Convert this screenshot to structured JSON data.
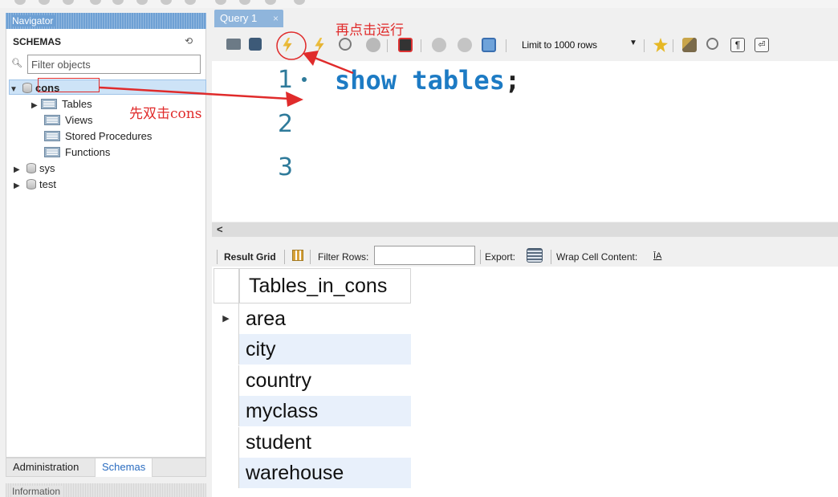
{
  "navigator": {
    "title": "Navigator",
    "schemas_label": "SCHEMAS",
    "filter_placeholder": "Filter objects",
    "tree": [
      {
        "label": "cons",
        "expanded": true,
        "selected": true
      },
      {
        "label": "Tables"
      },
      {
        "label": "Views"
      },
      {
        "label": "Stored Procedures"
      },
      {
        "label": "Functions"
      },
      {
        "label": "sys"
      },
      {
        "label": "test"
      }
    ],
    "bottom_tabs": [
      "Administration",
      "Schemas"
    ],
    "info_title": "Information"
  },
  "query_tab": {
    "label": "Query 1",
    "close": "×"
  },
  "toolbar": {
    "limit_label": "Limit to 1000 rows"
  },
  "editor": {
    "line_numbers": [
      "1",
      "2",
      "3"
    ],
    "code_keyword": "show tables",
    "code_semicolon": ";"
  },
  "result_bar": {
    "result_grid": "Result Grid",
    "filter_rows": "Filter Rows:",
    "export": "Export:",
    "wrap": "Wrap Cell Content:"
  },
  "result_grid": {
    "header": "Tables_in_cons",
    "rows": [
      "area",
      "city",
      "country",
      "myclass",
      "student",
      "warehouse"
    ]
  },
  "annotations": {
    "run_again": "再点击运行",
    "double_click": "先双击cons"
  },
  "colors": {
    "accent": "#6ea0d4",
    "annotation": "#e02b2b"
  }
}
